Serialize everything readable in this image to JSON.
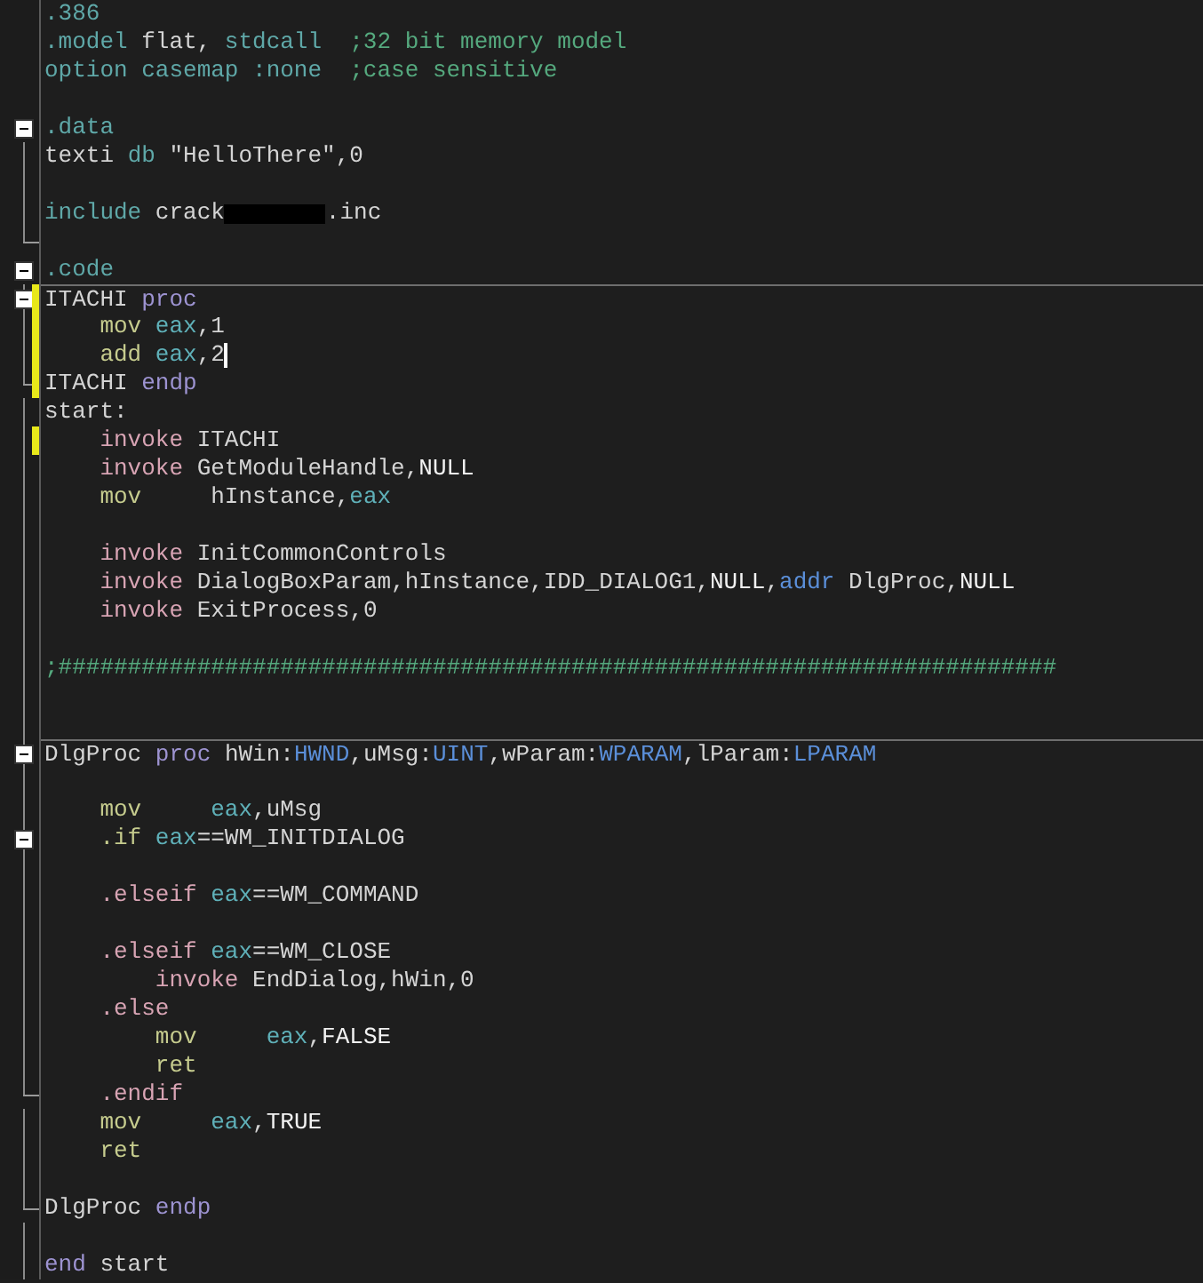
{
  "lines": [
    {
      "collapsible": false,
      "in_fold": false,
      "fold_end": false,
      "tokens": [
        {
          "text": ".386",
          "kind": "directive"
        }
      ]
    },
    {
      "collapsible": false,
      "in_fold": false,
      "fold_end": false,
      "tokens": [
        {
          "text": ".model",
          "kind": "directive"
        },
        {
          "text": " flat, ",
          "kind": "plain"
        },
        {
          "text": "stdcall",
          "kind": "directive"
        },
        {
          "text": "  ;32 bit memory model",
          "kind": "comment"
        }
      ]
    },
    {
      "collapsible": false,
      "in_fold": false,
      "fold_end": false,
      "tokens": [
        {
          "text": "option casemap :none",
          "kind": "directive"
        },
        {
          "text": "  ;case sensitive",
          "kind": "comment"
        }
      ]
    },
    {
      "collapsible": false,
      "in_fold": false,
      "fold_end": false
    },
    {
      "collapsible": true,
      "in_fold": false,
      "fold_end": false,
      "tokens": [
        {
          "text": ".data",
          "kind": "directive"
        }
      ]
    },
    {
      "collapsible": false,
      "in_fold": true,
      "fold_end": false,
      "tokens": [
        {
          "text": "texti ",
          "kind": "plain"
        },
        {
          "text": "db",
          "kind": "directive"
        },
        {
          "text": " \"HelloThere\",0",
          "kind": "plain"
        }
      ]
    },
    {
      "collapsible": false,
      "in_fold": true,
      "fold_end": false
    },
    {
      "collapsible": false,
      "in_fold": true,
      "fold_end": false,
      "tokens": [
        {
          "text": "include",
          "kind": "directive"
        },
        {
          "text": " crack",
          "kind": "plain"
        },
        {
          "kind": "redacted"
        },
        {
          "text": ".inc",
          "kind": "plain"
        }
      ]
    },
    {
      "collapsible": false,
      "in_fold": true,
      "fold_end": true
    },
    {
      "collapsible": true,
      "in_fold": false,
      "fold_end": false,
      "tokens": [
        {
          "text": ".code",
          "kind": "directive"
        }
      ]
    },
    {
      "collapsible": true,
      "in_fold": true,
      "fold_end": false,
      "changed": true,
      "divider": true,
      "tokens": [
        {
          "text": "ITACHI ",
          "kind": "plain"
        },
        {
          "text": "proc",
          "kind": "keyword"
        }
      ]
    },
    {
      "collapsible": false,
      "in_fold": true,
      "fold_end": false,
      "changed": true,
      "tokens": [
        {
          "text": "    mov ",
          "kind": "instr"
        },
        {
          "text": "eax",
          "kind": "reg"
        },
        {
          "text": ",1",
          "kind": "plain"
        }
      ]
    },
    {
      "collapsible": false,
      "in_fold": true,
      "fold_end": false,
      "changed": true,
      "cursor": true,
      "tokens": [
        {
          "text": "    add ",
          "kind": "instr"
        },
        {
          "text": "eax",
          "kind": "reg"
        },
        {
          "text": ",2",
          "kind": "plain"
        }
      ]
    },
    {
      "collapsible": false,
      "in_fold": true,
      "fold_end": true,
      "changed": true,
      "tokens": [
        {
          "text": "ITACHI ",
          "kind": "plain"
        },
        {
          "text": "endp",
          "kind": "keyword"
        }
      ]
    },
    {
      "collapsible": false,
      "in_fold": true,
      "fold_end": false,
      "tokens": [
        {
          "text": "start:",
          "kind": "plain"
        }
      ]
    },
    {
      "collapsible": false,
      "in_fold": true,
      "fold_end": false,
      "changed": true,
      "tokens": [
        {
          "text": "    invoke ",
          "kind": "macro"
        },
        {
          "text": "ITACHI",
          "kind": "plain"
        }
      ]
    },
    {
      "collapsible": false,
      "in_fold": true,
      "fold_end": false,
      "tokens": [
        {
          "text": "    invoke ",
          "kind": "macro"
        },
        {
          "text": "GetModuleHandle,",
          "kind": "plain"
        },
        {
          "text": "NULL",
          "kind": "const"
        }
      ]
    },
    {
      "collapsible": false,
      "in_fold": true,
      "fold_end": false,
      "tokens": [
        {
          "text": "    mov     ",
          "kind": "instr"
        },
        {
          "text": "hInstance,",
          "kind": "plain"
        },
        {
          "text": "eax",
          "kind": "reg"
        }
      ]
    },
    {
      "collapsible": false,
      "in_fold": true,
      "fold_end": false
    },
    {
      "collapsible": false,
      "in_fold": true,
      "fold_end": false,
      "tokens": [
        {
          "text": "    invoke ",
          "kind": "macro"
        },
        {
          "text": "InitCommonControls",
          "kind": "plain"
        }
      ]
    },
    {
      "collapsible": false,
      "in_fold": true,
      "fold_end": false,
      "tokens": [
        {
          "text": "    invoke ",
          "kind": "macro"
        },
        {
          "text": "DialogBoxParam,hInstance,IDD_DIALOG1,",
          "kind": "plain"
        },
        {
          "text": "NULL",
          "kind": "const"
        },
        {
          "text": ",",
          "kind": "plain"
        },
        {
          "text": "addr",
          "kind": "type"
        },
        {
          "text": " DlgProc,",
          "kind": "plain"
        },
        {
          "text": "NULL",
          "kind": "const"
        }
      ]
    },
    {
      "collapsible": false,
      "in_fold": true,
      "fold_end": false,
      "tokens": [
        {
          "text": "    invoke ",
          "kind": "macro"
        },
        {
          "text": "ExitProcess,0",
          "kind": "plain"
        }
      ]
    },
    {
      "collapsible": false,
      "in_fold": true,
      "fold_end": false
    },
    {
      "collapsible": false,
      "in_fold": true,
      "fold_end": false,
      "tokens": [
        {
          "text": ";########################################################################",
          "kind": "comment"
        }
      ]
    },
    {
      "collapsible": false,
      "in_fold": true,
      "fold_end": false
    },
    {
      "collapsible": false,
      "in_fold": true,
      "fold_end": false
    },
    {
      "collapsible": true,
      "in_fold": true,
      "fold_end": false,
      "divider": true,
      "tokens": [
        {
          "text": "DlgProc ",
          "kind": "plain"
        },
        {
          "text": "proc",
          "kind": "keyword"
        },
        {
          "text": " hWin:",
          "kind": "plain"
        },
        {
          "text": "HWND",
          "kind": "type"
        },
        {
          "text": ",uMsg:",
          "kind": "plain"
        },
        {
          "text": "UINT",
          "kind": "type"
        },
        {
          "text": ",wParam:",
          "kind": "plain"
        },
        {
          "text": "WPARAM",
          "kind": "type"
        },
        {
          "text": ",lParam:",
          "kind": "plain"
        },
        {
          "text": "LPARAM",
          "kind": "type"
        }
      ]
    },
    {
      "collapsible": false,
      "in_fold": true,
      "fold_end": false
    },
    {
      "collapsible": false,
      "in_fold": true,
      "fold_end": false,
      "tokens": [
        {
          "text": "    mov     ",
          "kind": "instr"
        },
        {
          "text": "eax",
          "kind": "reg"
        },
        {
          "text": ",uMsg",
          "kind": "plain"
        }
      ]
    },
    {
      "collapsible": true,
      "in_fold": true,
      "fold_end": false,
      "tokens": [
        {
          "text": "    .if ",
          "kind": "instr"
        },
        {
          "text": "eax",
          "kind": "reg"
        },
        {
          "text": "==WM_INITDIALOG",
          "kind": "plain"
        }
      ]
    },
    {
      "collapsible": false,
      "in_fold": true,
      "fold_end": false
    },
    {
      "collapsible": false,
      "in_fold": true,
      "fold_end": false,
      "tokens": [
        {
          "text": "    .elseif ",
          "kind": "macro"
        },
        {
          "text": "eax",
          "kind": "reg"
        },
        {
          "text": "==WM_COMMAND",
          "kind": "plain"
        }
      ]
    },
    {
      "collapsible": false,
      "in_fold": true,
      "fold_end": false
    },
    {
      "collapsible": false,
      "in_fold": true,
      "fold_end": false,
      "tokens": [
        {
          "text": "    .elseif ",
          "kind": "macro"
        },
        {
          "text": "eax",
          "kind": "reg"
        },
        {
          "text": "==WM_CLOSE",
          "kind": "plain"
        }
      ]
    },
    {
      "collapsible": false,
      "in_fold": true,
      "fold_end": false,
      "tokens": [
        {
          "text": "        invoke ",
          "kind": "macro"
        },
        {
          "text": "EndDialog,hWin,0",
          "kind": "plain"
        }
      ]
    },
    {
      "collapsible": false,
      "in_fold": true,
      "fold_end": false,
      "tokens": [
        {
          "text": "    .else",
          "kind": "macro"
        }
      ]
    },
    {
      "collapsible": false,
      "in_fold": true,
      "fold_end": false,
      "tokens": [
        {
          "text": "        mov     ",
          "kind": "instr"
        },
        {
          "text": "eax",
          "kind": "reg"
        },
        {
          "text": ",",
          "kind": "plain"
        },
        {
          "text": "FALSE",
          "kind": "const"
        }
      ]
    },
    {
      "collapsible": false,
      "in_fold": true,
      "fold_end": false,
      "tokens": [
        {
          "text": "        ret",
          "kind": "instr"
        }
      ]
    },
    {
      "collapsible": false,
      "in_fold": true,
      "fold_end": true,
      "tokens": [
        {
          "text": "    .endif",
          "kind": "macro"
        }
      ]
    },
    {
      "collapsible": false,
      "in_fold": true,
      "fold_end": false,
      "tokens": [
        {
          "text": "    mov     ",
          "kind": "instr"
        },
        {
          "text": "eax",
          "kind": "reg"
        },
        {
          "text": ",",
          "kind": "plain"
        },
        {
          "text": "TRUE",
          "kind": "const"
        }
      ]
    },
    {
      "collapsible": false,
      "in_fold": true,
      "fold_end": false,
      "tokens": [
        {
          "text": "    ret",
          "kind": "instr"
        }
      ]
    },
    {
      "collapsible": false,
      "in_fold": true,
      "fold_end": false
    },
    {
      "collapsible": false,
      "in_fold": true,
      "fold_end": true,
      "tokens": [
        {
          "text": "DlgProc ",
          "kind": "plain"
        },
        {
          "text": "endp",
          "kind": "keyword"
        }
      ]
    },
    {
      "collapsible": false,
      "in_fold": true,
      "fold_end": false
    },
    {
      "collapsible": false,
      "in_fold": true,
      "fold_end": false,
      "tokens": [
        {
          "text": "end",
          "kind": "keyword"
        },
        {
          "text": " start",
          "kind": "plain"
        }
      ]
    }
  ]
}
